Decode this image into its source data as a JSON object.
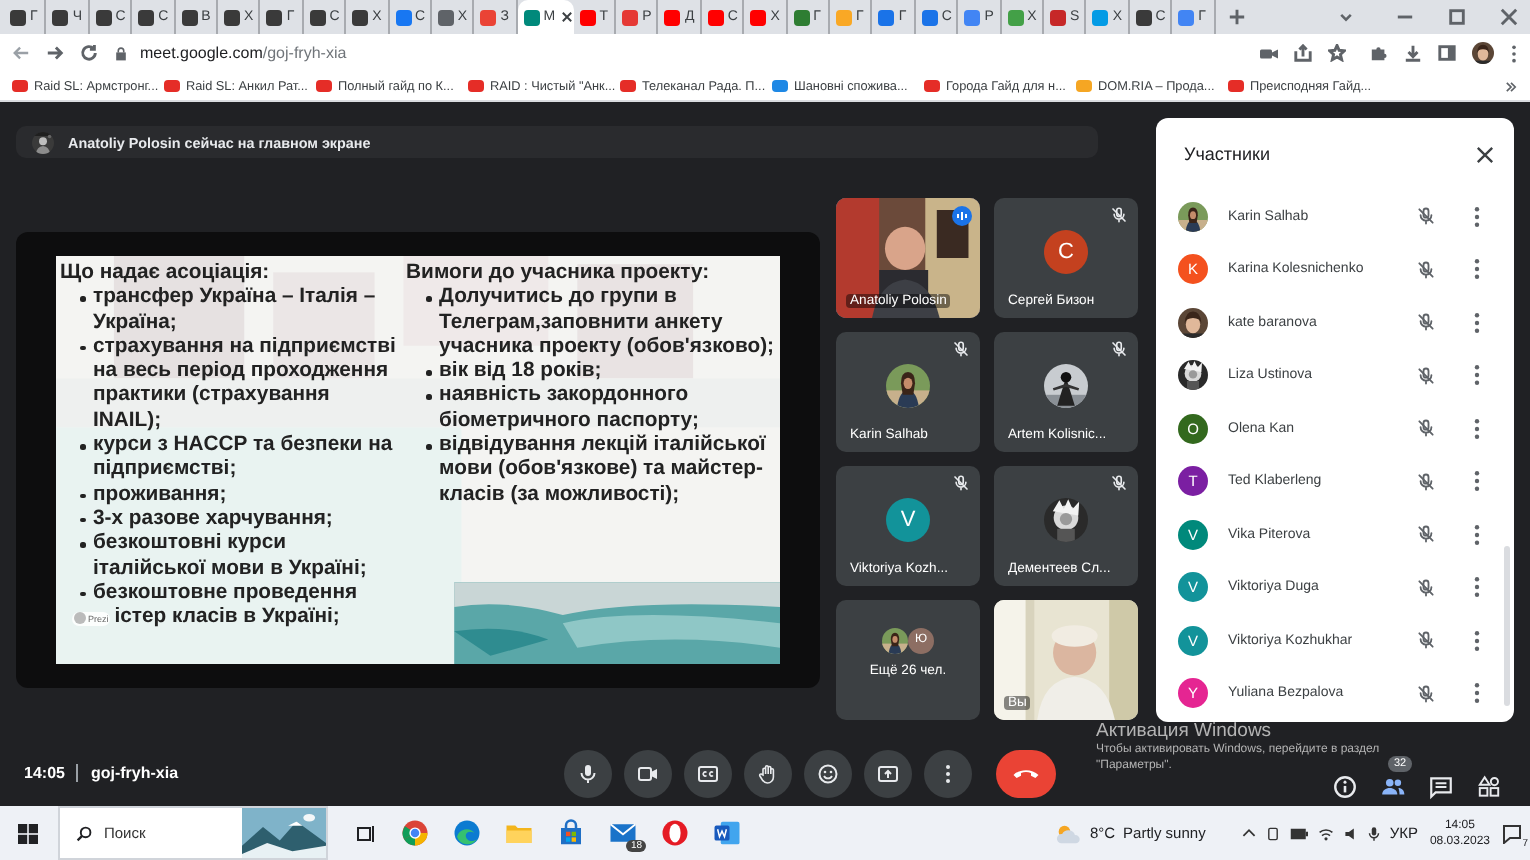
{
  "browser": {
    "tabs": [
      {
        "title": "Г",
        "color": "#3a3a3a",
        "selected": false
      },
      {
        "title": "Ч",
        "color": "#3a3a3a",
        "selected": false
      },
      {
        "title": "С",
        "color": "#3a3a3a",
        "selected": false
      },
      {
        "title": "С",
        "color": "#3a3a3a",
        "selected": false
      },
      {
        "title": "В",
        "color": "#3a3a3a",
        "selected": false
      },
      {
        "title": "Х",
        "color": "#3a3a3a",
        "selected": false
      },
      {
        "title": "Г",
        "color": "#3a3a3a",
        "selected": false
      },
      {
        "title": "С",
        "color": "#3a3a3a",
        "selected": false
      },
      {
        "title": "Х",
        "color": "#3a3a3a",
        "selected": false
      },
      {
        "title": "С",
        "color": "#1877f2",
        "selected": false
      },
      {
        "title": "Х",
        "color": "#5f6368",
        "selected": false
      },
      {
        "title": "З",
        "color": "#ea4335",
        "selected": false
      },
      {
        "title": "М",
        "color": "#00897b",
        "selected": true
      },
      {
        "title": "Т",
        "color": "#ff0000",
        "selected": false
      },
      {
        "title": "Р",
        "color": "#e53935",
        "selected": false
      },
      {
        "title": "Д",
        "color": "#ff0000",
        "selected": false
      },
      {
        "title": "С",
        "color": "#ff0000",
        "selected": false
      },
      {
        "title": "Х",
        "color": "#ff0000",
        "selected": false
      },
      {
        "title": "Г",
        "color": "#2e7d32",
        "selected": false
      },
      {
        "title": "Г",
        "color": "#f9a825",
        "selected": false
      },
      {
        "title": "Г",
        "color": "#1a73e8",
        "selected": false
      },
      {
        "title": "С",
        "color": "#1a73e8",
        "selected": false
      },
      {
        "title": "Р",
        "color": "#4285f4",
        "selected": false
      },
      {
        "title": "Х",
        "color": "#43a047",
        "selected": false
      },
      {
        "title": "S",
        "color": "#c62828",
        "selected": false
      },
      {
        "title": "Х",
        "color": "#039be5",
        "selected": false
      },
      {
        "title": "С",
        "color": "#3a3a3a",
        "selected": false
      },
      {
        "title": "Г",
        "color": "#4285f4",
        "selected": false
      }
    ],
    "url": {
      "host": "meet.google.com",
      "path": "/goj-fryh-xia"
    },
    "bookmarks": [
      {
        "label": "Raid SL: Армстронг...",
        "color": "#e52d27"
      },
      {
        "label": "Raid SL: Анкил Рат...",
        "color": "#e52d27"
      },
      {
        "label": "Полный гайд по К...",
        "color": "#e52d27"
      },
      {
        "label": "RAID : Чистый \"Анк...",
        "color": "#e52d27"
      },
      {
        "label": "Телеканал Рада. П...",
        "color": "#e52d27"
      },
      {
        "label": "Шановні спожива...",
        "color": "#1e88e5"
      },
      {
        "label": "Города Гайд для н...",
        "color": "#e52d27"
      },
      {
        "label": "DOM.RIA – Прода...",
        "color": "#f5a623"
      },
      {
        "label": "Преисподняя Гайд...",
        "color": "#e52d27"
      }
    ]
  },
  "meeting": {
    "presenter_banner": "Anatoliy Polosin сейчас на главном экране",
    "slide": {
      "columns": [
        {
          "heading": "Що надає асоціація:",
          "items": [
            {
              "text": "трансфер Україна – Італія – Україна;"
            },
            {
              "text": "страхування на підприємстві на весь період проходження практики (страхування INAIL);"
            },
            {
              "text": "курси з HACCP та безпеки на підприємстві;"
            },
            {
              "text": "проживання;"
            },
            {
              "text": "3-х разове харчування;"
            },
            {
              "text": "безкоштовні курси італійської мови в Україні;"
            },
            {
              "text": "безкоштовне проведення",
              "continuation": "істер класів в Україні;"
            }
          ]
        },
        {
          "heading": "Вимоги до учасника проекту:",
          "items": [
            {
              "text": "Долучитись до групи в Телеграм,заповнити анкету учасника проекту (обов'язково);"
            },
            {
              "text": "вік від 18 років;"
            },
            {
              "text": "наявність закордонного біометричного паспорту;"
            },
            {
              "text": "відвідування лекцій італійської мови (обов'язкове)  та майстер-класів (за можливості);"
            }
          ]
        }
      ],
      "badge": "Prezi"
    },
    "tiles": [
      {
        "kind": "video",
        "name": "Anatoliy Polosin",
        "muted": false,
        "speaking": true
      },
      {
        "kind": "initial",
        "name": "Сергей Бизон",
        "letter": "С",
        "color": "#c4411f",
        "muted": true,
        "speaking": false
      },
      {
        "name": "Karin Salhab",
        "muted": true,
        "speaking": false
      },
      {
        "name": "Artem Kolisnic...",
        "muted": true,
        "speaking": false
      },
      {
        "kind": "initial",
        "name": "Viktoriya Kozh...",
        "letter": "V",
        "color": "#12939a",
        "muted": true,
        "speaking": false
      },
      {
        "name": "Дементеев Сл...",
        "muted": true,
        "speaking": false
      },
      {
        "kind": "more",
        "name": "Ещё 26 чел.",
        "letter": "Ю",
        "color": "#8d6e63",
        "muted": false,
        "speaking": false
      },
      {
        "kind": "self",
        "name": "Вы",
        "muted": false,
        "speaking": false
      }
    ],
    "participants": {
      "title": "Участники",
      "people": [
        {
          "name": "Karin Salhab",
          "muted": true
        },
        {
          "name": "Karina Kolesnichenko",
          "kind": "initial",
          "letter": "K",
          "color": "#f4511e",
          "muted": true
        },
        {
          "name": "kate baranova",
          "muted": true
        },
        {
          "name": "Liza Ustinova",
          "muted": true
        },
        {
          "name": "Olena Kan",
          "kind": "initial",
          "letter": "O",
          "color": "#33691e",
          "muted": true
        },
        {
          "name": "Ted Klaberleng",
          "kind": "initial",
          "letter": "T",
          "color": "#7b1fa2",
          "muted": true
        },
        {
          "name": "Vika Piterova",
          "kind": "initial",
          "letter": "V",
          "color": "#00897b",
          "muted": true
        },
        {
          "name": "Viktoriya Duga",
          "kind": "initial",
          "letter": "V",
          "color": "#12939a",
          "muted": true
        },
        {
          "name": "Viktoriya Kozhukhar",
          "kind": "initial",
          "letter": "V",
          "color": "#12939a",
          "muted": true
        },
        {
          "name": "Yuliana Bezpalova",
          "kind": "initial",
          "letter": "Y",
          "color": "#e52592",
          "muted": true
        }
      ]
    },
    "bar": {
      "time": "14:05",
      "code": "goj-fryh-xia",
      "controls": [
        {
          "kind": "mic"
        },
        {
          "kind": "camera"
        },
        {
          "kind": "captions"
        },
        {
          "kind": "hand"
        },
        {
          "kind": "emoji"
        },
        {
          "kind": "present"
        },
        {
          "kind": "more"
        },
        {
          "kind": "end"
        }
      ],
      "side": [
        {
          "kind": "info",
          "selected": false
        },
        {
          "kind": "people",
          "selected": true,
          "badge": "32"
        },
        {
          "kind": "chat",
          "selected": false
        },
        {
          "kind": "activities",
          "selected": false
        }
      ]
    }
  },
  "os_notice": {
    "title": "Активация Windows",
    "lines": [
      "Чтобы активировать Windows, перейдите в раздел",
      "\"Параметры\"."
    ]
  },
  "taskbar": {
    "search": {
      "placeholder": "Поиск"
    },
    "apps": [
      {
        "kind": "chrome"
      },
      {
        "kind": "edge"
      },
      {
        "kind": "folder"
      },
      {
        "kind": "store"
      },
      {
        "kind": "mail",
        "badge": "18"
      },
      {
        "kind": "opera"
      },
      {
        "kind": "word"
      }
    ],
    "weather": {
      "temp": "8°C",
      "text": "Partly sunny"
    },
    "language": "УКР",
    "time": "14:05",
    "date": "08.03.2023",
    "notifications": "7"
  }
}
